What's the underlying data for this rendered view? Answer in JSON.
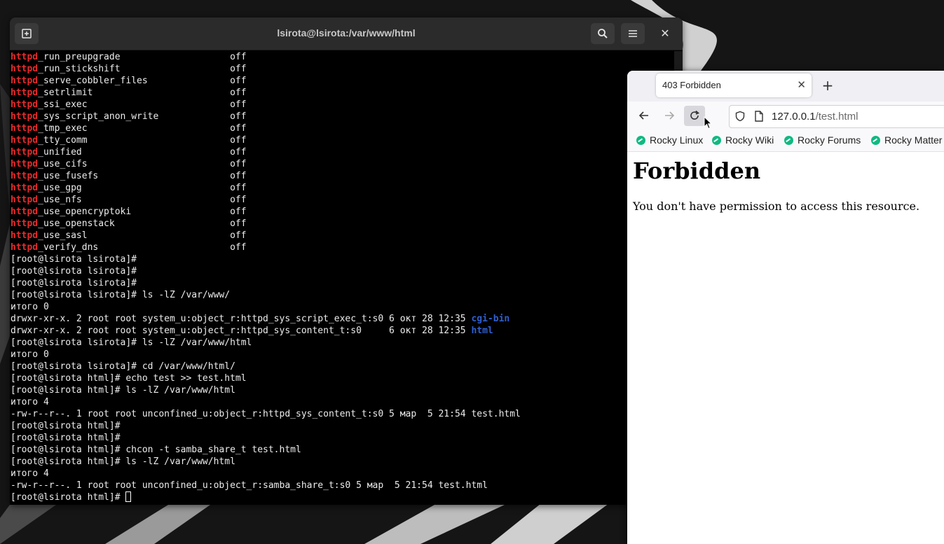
{
  "terminal": {
    "title": "lsirota@lsirota:/var/www/html",
    "lines": [
      {
        "segments": [
          {
            "t": "httpd",
            "c": "kw"
          },
          {
            "t": "_run_preupgrade                    off"
          }
        ]
      },
      {
        "segments": [
          {
            "t": "httpd",
            "c": "kw"
          },
          {
            "t": "_run_stickshift                    off"
          }
        ]
      },
      {
        "segments": [
          {
            "t": "httpd",
            "c": "kw"
          },
          {
            "t": "_serve_cobbler_files               off"
          }
        ]
      },
      {
        "segments": [
          {
            "t": "httpd",
            "c": "kw"
          },
          {
            "t": "_setrlimit                         off"
          }
        ]
      },
      {
        "segments": [
          {
            "t": "httpd",
            "c": "kw"
          },
          {
            "t": "_ssi_exec                          off"
          }
        ]
      },
      {
        "segments": [
          {
            "t": "httpd",
            "c": "kw"
          },
          {
            "t": "_sys_script_anon_write             off"
          }
        ]
      },
      {
        "segments": [
          {
            "t": "httpd",
            "c": "kw"
          },
          {
            "t": "_tmp_exec                          off"
          }
        ]
      },
      {
        "segments": [
          {
            "t": "httpd",
            "c": "kw"
          },
          {
            "t": "_tty_comm                          off"
          }
        ]
      },
      {
        "segments": [
          {
            "t": "httpd",
            "c": "kw"
          },
          {
            "t": "_unified                           off"
          }
        ]
      },
      {
        "segments": [
          {
            "t": "httpd",
            "c": "kw"
          },
          {
            "t": "_use_cifs                          off"
          }
        ]
      },
      {
        "segments": [
          {
            "t": "httpd",
            "c": "kw"
          },
          {
            "t": "_use_fusefs                        off"
          }
        ]
      },
      {
        "segments": [
          {
            "t": "httpd",
            "c": "kw"
          },
          {
            "t": "_use_gpg                           off"
          }
        ]
      },
      {
        "segments": [
          {
            "t": "httpd",
            "c": "kw"
          },
          {
            "t": "_use_nfs                           off"
          }
        ]
      },
      {
        "segments": [
          {
            "t": "httpd",
            "c": "kw"
          },
          {
            "t": "_use_opencryptoki                  off"
          }
        ]
      },
      {
        "segments": [
          {
            "t": "httpd",
            "c": "kw"
          },
          {
            "t": "_use_openstack                     off"
          }
        ]
      },
      {
        "segments": [
          {
            "t": "httpd",
            "c": "kw"
          },
          {
            "t": "_use_sasl                          off"
          }
        ]
      },
      {
        "segments": [
          {
            "t": "httpd",
            "c": "kw"
          },
          {
            "t": "_verify_dns                        off"
          }
        ]
      },
      {
        "segments": [
          {
            "t": "[root@lsirota lsirota]#"
          }
        ]
      },
      {
        "segments": [
          {
            "t": "[root@lsirota lsirota]#"
          }
        ]
      },
      {
        "segments": [
          {
            "t": "[root@lsirota lsirota]#"
          }
        ]
      },
      {
        "segments": [
          {
            "t": "[root@lsirota lsirota]# ls -lZ /var/www/"
          }
        ]
      },
      {
        "segments": [
          {
            "t": "итого 0"
          }
        ]
      },
      {
        "segments": [
          {
            "t": "drwxr-xr-x. 2 root root system_u:object_r:httpd_sys_script_exec_t:s0 6 окт 28 12:35 "
          },
          {
            "t": "cgi-bin",
            "c": "dir"
          }
        ]
      },
      {
        "segments": [
          {
            "t": "drwxr-xr-x. 2 root root system_u:object_r:httpd_sys_content_t:s0     6 окт 28 12:35 "
          },
          {
            "t": "html",
            "c": "dir"
          }
        ]
      },
      {
        "segments": [
          {
            "t": "[root@lsirota lsirota]# ls -lZ /var/www/html"
          }
        ]
      },
      {
        "segments": [
          {
            "t": "итого 0"
          }
        ]
      },
      {
        "segments": [
          {
            "t": "[root@lsirota lsirota]# cd /var/www/html/"
          }
        ]
      },
      {
        "segments": [
          {
            "t": "[root@lsirota html]# echo test >> test.html"
          }
        ]
      },
      {
        "segments": [
          {
            "t": "[root@lsirota html]# ls -lZ /var/www/html"
          }
        ]
      },
      {
        "segments": [
          {
            "t": "итого 4"
          }
        ]
      },
      {
        "segments": [
          {
            "t": "-rw-r--r--. 1 root root unconfined_u:object_r:httpd_sys_content_t:s0 5 мар  5 21:54 test.html"
          }
        ]
      },
      {
        "segments": [
          {
            "t": "[root@lsirota html]#"
          }
        ]
      },
      {
        "segments": [
          {
            "t": "[root@lsirota html]#"
          }
        ]
      },
      {
        "segments": [
          {
            "t": "[root@lsirota html]# chcon -t samba_share_t test.html"
          }
        ]
      },
      {
        "segments": [
          {
            "t": "[root@lsirota html]# ls -lZ /var/www/html"
          }
        ]
      },
      {
        "segments": [
          {
            "t": "итого 4"
          }
        ]
      },
      {
        "segments": [
          {
            "t": "-rw-r--r--. 1 root root unconfined_u:object_r:samba_share_t:s0 5 мар  5 21:54 test.html"
          }
        ]
      },
      {
        "segments": [
          {
            "t": "[root@lsirota html]# "
          }
        ],
        "cursor": true
      }
    ]
  },
  "browser": {
    "tab_title": "403 Forbidden",
    "url_host": "127.0.0.1",
    "url_path": "/test.html",
    "bookmarks": [
      "Rocky Linux",
      "Rocky Wiki",
      "Rocky Forums",
      "Rocky Matter"
    ],
    "page_heading": "Forbidden",
    "page_text": "You don't have permission to access this resource."
  }
}
